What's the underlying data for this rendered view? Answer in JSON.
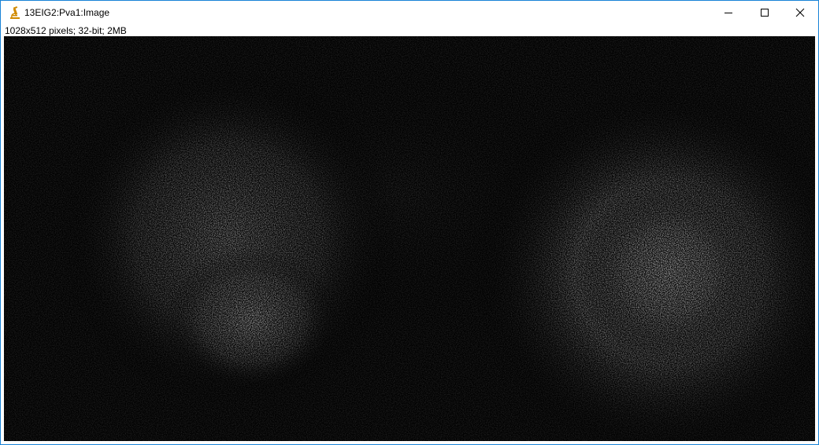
{
  "window": {
    "title": "13EIG2:Pva1:Image",
    "icon": "microscope-icon",
    "controls": [
      "minimize-icon",
      "maximize-icon",
      "close-icon"
    ],
    "border_color": "#1883d7"
  },
  "image_info": "1028x512 pixels; 32-bit; 2MB",
  "image": {
    "description_colors": {
      "background": "#000000",
      "blob": "#ffffff"
    }
  }
}
